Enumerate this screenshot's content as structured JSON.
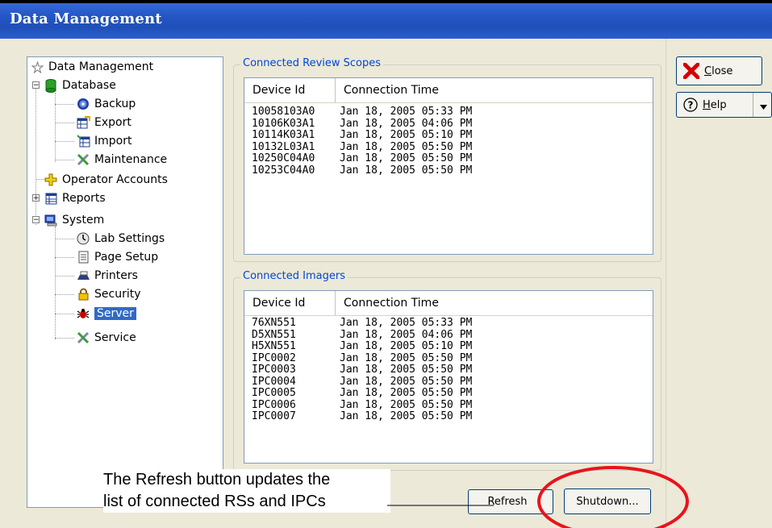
{
  "window": {
    "title": "Data Management"
  },
  "tree": {
    "root": "Data Management",
    "database": "Database",
    "backup": "Backup",
    "export": "Export",
    "import": "Import",
    "maintenance": "Maintenance",
    "operator_accounts": "Operator Accounts",
    "reports": "Reports",
    "system": "System",
    "lab_settings": "Lab Settings",
    "page_setup": "Page Setup",
    "printers": "Printers",
    "security": "Security",
    "server": "Server",
    "service": "Service"
  },
  "review_scopes": {
    "legend": "Connected Review Scopes",
    "col_device": "Device Id",
    "col_time": "Connection Time",
    "rows": [
      {
        "device": "10058103A0",
        "time": "Jan 18, 2005 05:33 PM"
      },
      {
        "device": "10106K03A1",
        "time": "Jan 18, 2005 04:06 PM"
      },
      {
        "device": "10114K03A1",
        "time": "Jan 18, 2005 05:10 PM"
      },
      {
        "device": "10132L03A1",
        "time": "Jan 18, 2005 05:50 PM"
      },
      {
        "device": "10250C04A0",
        "time": "Jan 18, 2005 05:50 PM"
      },
      {
        "device": "10253C04A0",
        "time": "Jan 18, 2005 05:50 PM"
      }
    ]
  },
  "imagers": {
    "legend": "Connected Imagers",
    "col_device": "Device Id",
    "col_time": "Connection Time",
    "rows": [
      {
        "device": "76XN551",
        "time": "Jan 18, 2005 05:33 PM"
      },
      {
        "device": "D5XN551",
        "time": "Jan 18, 2005 04:06 PM"
      },
      {
        "device": "H5XN551",
        "time": "Jan 18, 2005 05:10 PM"
      },
      {
        "device": "IPC0002",
        "time": "Jan 18, 2005 05:50 PM"
      },
      {
        "device": "IPC0003",
        "time": "Jan 18, 2005 05:50 PM"
      },
      {
        "device": "IPC0004",
        "time": "Jan 18, 2005 05:50 PM"
      },
      {
        "device": "IPC0005",
        "time": "Jan 18, 2005 05:50 PM"
      },
      {
        "device": "IPC0006",
        "time": "Jan 18, 2005 05:50 PM"
      },
      {
        "device": "IPC0007",
        "time": "Jan 18, 2005 05:50 PM"
      }
    ]
  },
  "buttons": {
    "close_first": "C",
    "close_rest": "lose",
    "help_first": "H",
    "help_rest": "elp",
    "refresh": "Refresh",
    "shutdown": "Shutdown..."
  },
  "annotation": {
    "line1": "The Refresh button updates the",
    "line2": "list of connected RSs and IPCs"
  },
  "colors": {
    "highlight_circle": "#e8141c",
    "selection": "#316ac5",
    "legend": "#0046d5"
  }
}
